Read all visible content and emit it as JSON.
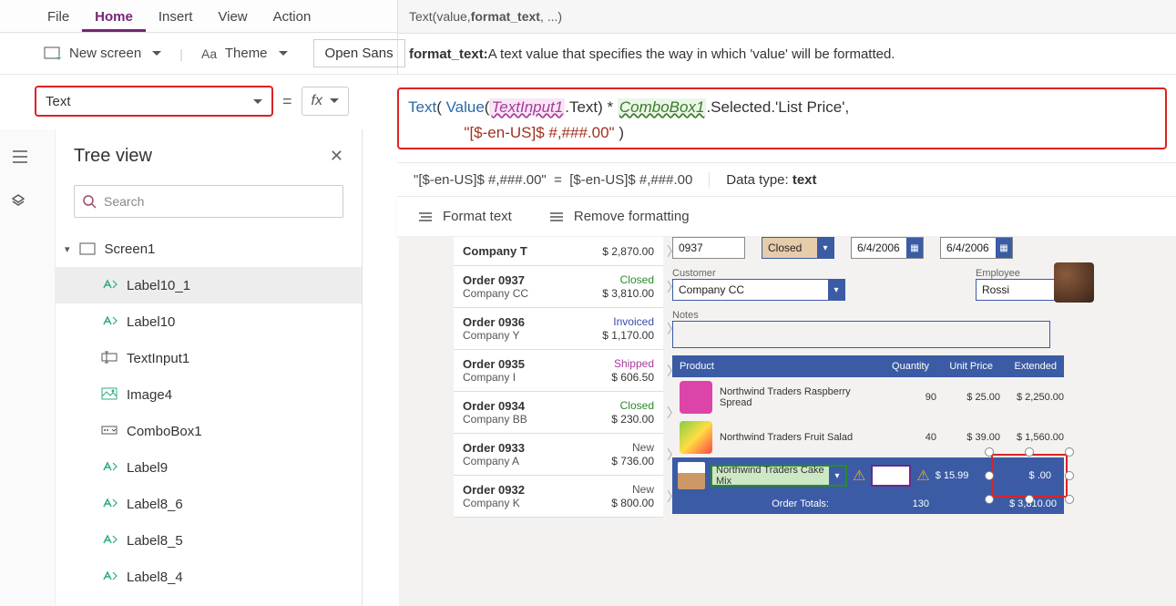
{
  "menu": {
    "file": "File",
    "home": "Home",
    "insert": "Insert",
    "view": "View",
    "action": "Action"
  },
  "toolbar": {
    "newscreen": "New screen",
    "theme": "Theme",
    "font": "Open Sans"
  },
  "prop": {
    "selected": "Text",
    "equals": "=",
    "fx": "fx"
  },
  "hint": {
    "prefix": "Text(value, ",
    "bold": "format_text",
    "suffix": ", ...)"
  },
  "desc": {
    "label": "format_text:",
    "text": " A text value that specifies the way in which 'value' will be formatted."
  },
  "formula": {
    "fn1": "Text",
    "fn2": "Value",
    "ctrl1": "TextInput1",
    "p1": ".Text) * ",
    "ctrl2": "ComboBox1",
    "p2": ".Selected.'List Price',",
    "str": "\"[$-en-US]$ #,###.00\"",
    "close": " )"
  },
  "result": {
    "lhs": "\"[$-en-US]$ #,###.00\"",
    "equals": "=",
    "rhs": "[$-en-US]$ #,###.00",
    "dtlabel": "Data type: ",
    "dtype": "text"
  },
  "fmt": {
    "format": "Format text",
    "remove": "Remove formatting"
  },
  "tree": {
    "title": "Tree view",
    "search": "Search",
    "root": "Screen1",
    "items": [
      "Label10_1",
      "Label10",
      "TextInput1",
      "Image4",
      "ComboBox1",
      "Label9",
      "Label8_6",
      "Label8_5",
      "Label8_4"
    ]
  },
  "orders": [
    {
      "title": "Company T",
      "sub": "",
      "status": "",
      "price": "$ 2,870.00"
    },
    {
      "title": "Order 0937",
      "sub": "Company CC",
      "status": "Closed",
      "scls": "closed",
      "price": "$ 3,810.00"
    },
    {
      "title": "Order 0936",
      "sub": "Company Y",
      "status": "Invoiced",
      "scls": "invoiced",
      "price": "$ 1,170.00"
    },
    {
      "title": "Order 0935",
      "sub": "Company I",
      "status": "Shipped",
      "scls": "shipped",
      "price": "$ 606.50"
    },
    {
      "title": "Order 0934",
      "sub": "Company BB",
      "status": "Closed",
      "scls": "closed",
      "price": "$ 230.00"
    },
    {
      "title": "Order 0933",
      "sub": "Company A",
      "status": "New",
      "scls": "new",
      "price": "$ 736.00"
    },
    {
      "title": "Order 0932",
      "sub": "Company K",
      "status": "New",
      "scls": "new",
      "price": "$ 800.00"
    }
  ],
  "detail": {
    "ordernum": "0937",
    "status": "Closed",
    "date1": "6/4/2006",
    "date2": "6/4/2006",
    "custlabel": "Customer",
    "customer": "Company CC",
    "emplabel": "Employee",
    "employee": "Rossi",
    "noteslabel": "Notes",
    "headers": {
      "p": "Product",
      "q": "Quantity",
      "u": "Unit Price",
      "e": "Extended"
    },
    "rows": [
      {
        "name": "Northwind Traders Raspberry Spread",
        "qty": "90",
        "unit": "$ 25.00",
        "ext": "$ 2,250.00"
      },
      {
        "name": "Northwind Traders Fruit Salad",
        "qty": "40",
        "unit": "$ 39.00",
        "ext": "$ 1,560.00"
      }
    ],
    "newprod": "Northwind Traders Cake Mix",
    "newunit": "$ 15.99",
    "newext": "$ .00",
    "totlabel": "Order Totals:",
    "totqty": "130",
    "totext": "$ 3,810.00"
  }
}
